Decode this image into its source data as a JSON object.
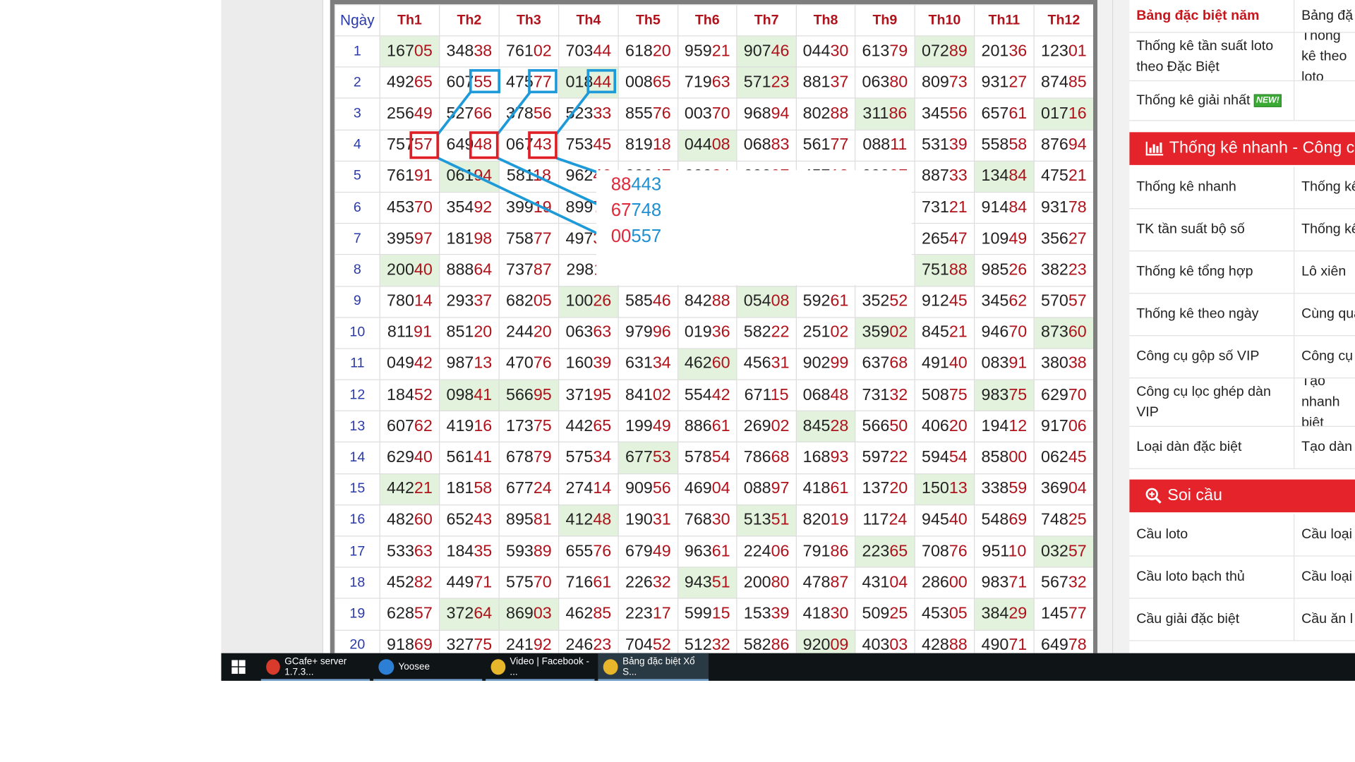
{
  "table": {
    "headers": [
      "Ngày",
      "Th1",
      "Th2",
      "Th3",
      "Th4",
      "Th5",
      "Th6",
      "Th7",
      "Th8",
      "Th9",
      "Th10",
      "Th11",
      "Th12"
    ],
    "rows": [
      {
        "day": "1",
        "cells": [
          {
            "v": "16705",
            "hl": true
          },
          {
            "v": "34838"
          },
          {
            "v": "76102"
          },
          {
            "v": "70344"
          },
          {
            "v": "61820"
          },
          {
            "v": "95921"
          },
          {
            "v": "90746",
            "hl": true
          },
          {
            "v": "04430"
          },
          {
            "v": "61379"
          },
          {
            "v": "07289",
            "hl": true
          },
          {
            "v": "20136"
          },
          {
            "v": "12301"
          }
        ]
      },
      {
        "day": "2",
        "cells": [
          {
            "v": "49265"
          },
          {
            "v": "60755"
          },
          {
            "v": "47577"
          },
          {
            "v": "01844",
            "hl": true
          },
          {
            "v": "00865"
          },
          {
            "v": "71963"
          },
          {
            "v": "57123",
            "hl": true
          },
          {
            "v": "88137"
          },
          {
            "v": "06380"
          },
          {
            "v": "80973"
          },
          {
            "v": "93127"
          },
          {
            "v": "87485"
          }
        ]
      },
      {
        "day": "3",
        "cells": [
          {
            "v": "25649"
          },
          {
            "v": "52766"
          },
          {
            "v": "37856"
          },
          {
            "v": "52333"
          },
          {
            "v": "85576"
          },
          {
            "v": "00370"
          },
          {
            "v": "96894"
          },
          {
            "v": "80288"
          },
          {
            "v": "31186",
            "hl": true
          },
          {
            "v": "34556"
          },
          {
            "v": "65761"
          },
          {
            "v": "01716",
            "hl": true
          }
        ]
      },
      {
        "day": "4",
        "cells": [
          {
            "v": "75757"
          },
          {
            "v": "64948"
          },
          {
            "v": "06743"
          },
          {
            "v": "75345"
          },
          {
            "v": "81918"
          },
          {
            "v": "04408",
            "hl": true
          },
          {
            "v": "06883"
          },
          {
            "v": "56177"
          },
          {
            "v": "08811"
          },
          {
            "v": "53139"
          },
          {
            "v": "55858"
          },
          {
            "v": "87694"
          }
        ]
      },
      {
        "day": "5",
        "cells": [
          {
            "v": "76191"
          },
          {
            "v": "06194",
            "hl": true
          },
          {
            "v": "58118"
          },
          {
            "v": "96246"
          },
          {
            "v": "09047"
          },
          {
            "v": "09034"
          },
          {
            "v": "09097"
          },
          {
            "v": "45718"
          },
          {
            "v": "09097"
          },
          {
            "v": "88733"
          },
          {
            "v": "13484",
            "hl": true
          },
          {
            "v": "47521"
          }
        ]
      },
      {
        "day": "6",
        "cells": [
          {
            "v": "45370"
          },
          {
            "v": "35492"
          },
          {
            "v": "39919"
          },
          {
            "v": "89977"
          },
          {
            "v": ""
          },
          {
            "v": ""
          },
          {
            "v": ""
          },
          {
            "v": ""
          },
          {
            "v": ""
          },
          {
            "v": "73121"
          },
          {
            "v": "91484"
          },
          {
            "v": "93178"
          }
        ]
      },
      {
        "day": "7",
        "cells": [
          {
            "v": "39597"
          },
          {
            "v": "18198"
          },
          {
            "v": "75877"
          },
          {
            "v": "49733"
          },
          {
            "v": ""
          },
          {
            "v": ""
          },
          {
            "v": ""
          },
          {
            "v": ""
          },
          {
            "v": ""
          },
          {
            "v": "26547"
          },
          {
            "v": "10949"
          },
          {
            "v": "35627"
          }
        ]
      },
      {
        "day": "8",
        "cells": [
          {
            "v": "20040",
            "hl": true
          },
          {
            "v": "88864"
          },
          {
            "v": "73787"
          },
          {
            "v": "29811"
          },
          {
            "v": ""
          },
          {
            "v": ""
          },
          {
            "v": ""
          },
          {
            "v": ""
          },
          {
            "v": ""
          },
          {
            "v": "75188",
            "hl": true
          },
          {
            "v": "98526"
          },
          {
            "v": "38223"
          }
        ]
      },
      {
        "day": "9",
        "cells": [
          {
            "v": "78014"
          },
          {
            "v": "29337"
          },
          {
            "v": "68205"
          },
          {
            "v": "10026",
            "hl": true
          },
          {
            "v": "58546"
          },
          {
            "v": "84288"
          },
          {
            "v": "05408",
            "hl": true
          },
          {
            "v": "59261"
          },
          {
            "v": "35252"
          },
          {
            "v": "91245"
          },
          {
            "v": "34562"
          },
          {
            "v": "57057"
          }
        ]
      },
      {
        "day": "10",
        "cells": [
          {
            "v": "81191"
          },
          {
            "v": "85120"
          },
          {
            "v": "24420"
          },
          {
            "v": "06363"
          },
          {
            "v": "97996"
          },
          {
            "v": "01936"
          },
          {
            "v": "58222"
          },
          {
            "v": "25102"
          },
          {
            "v": "35902",
            "hl": true
          },
          {
            "v": "84521"
          },
          {
            "v": "94670"
          },
          {
            "v": "87360",
            "hl": true
          }
        ]
      },
      {
        "day": "11",
        "cells": [
          {
            "v": "04942"
          },
          {
            "v": "98713"
          },
          {
            "v": "47076"
          },
          {
            "v": "16039"
          },
          {
            "v": "63134"
          },
          {
            "v": "46260",
            "hl": true
          },
          {
            "v": "45631"
          },
          {
            "v": "90299"
          },
          {
            "v": "63768"
          },
          {
            "v": "49140"
          },
          {
            "v": "08391"
          },
          {
            "v": "38038"
          }
        ]
      },
      {
        "day": "12",
        "cells": [
          {
            "v": "18452"
          },
          {
            "v": "09841",
            "hl": true
          },
          {
            "v": "56695",
            "hl": true
          },
          {
            "v": "37195"
          },
          {
            "v": "84102"
          },
          {
            "v": "55442"
          },
          {
            "v": "67115"
          },
          {
            "v": "06848"
          },
          {
            "v": "73132"
          },
          {
            "v": "50875"
          },
          {
            "v": "98375",
            "hl": true
          },
          {
            "v": "62970"
          }
        ]
      },
      {
        "day": "13",
        "cells": [
          {
            "v": "60762"
          },
          {
            "v": "41916"
          },
          {
            "v": "17375"
          },
          {
            "v": "44265"
          },
          {
            "v": "19949"
          },
          {
            "v": "88661"
          },
          {
            "v": "26902"
          },
          {
            "v": "84528",
            "hl": true
          },
          {
            "v": "56650"
          },
          {
            "v": "40620"
          },
          {
            "v": "19412"
          },
          {
            "v": "91706"
          }
        ]
      },
      {
        "day": "14",
        "cells": [
          {
            "v": "62940"
          },
          {
            "v": "56141"
          },
          {
            "v": "67879"
          },
          {
            "v": "57534"
          },
          {
            "v": "67753",
            "hl": true
          },
          {
            "v": "57854"
          },
          {
            "v": "78668"
          },
          {
            "v": "16893"
          },
          {
            "v": "59722"
          },
          {
            "v": "59454"
          },
          {
            "v": "85800"
          },
          {
            "v": "06245"
          }
        ]
      },
      {
        "day": "15",
        "cells": [
          {
            "v": "44221",
            "hl": true
          },
          {
            "v": "18158"
          },
          {
            "v": "67724"
          },
          {
            "v": "27414"
          },
          {
            "v": "90956"
          },
          {
            "v": "46904"
          },
          {
            "v": "08897"
          },
          {
            "v": "41861"
          },
          {
            "v": "13720"
          },
          {
            "v": "15013",
            "hl": true
          },
          {
            "v": "33859"
          },
          {
            "v": "36904"
          }
        ]
      },
      {
        "day": "16",
        "cells": [
          {
            "v": "48260"
          },
          {
            "v": "65243"
          },
          {
            "v": "89581"
          },
          {
            "v": "41248",
            "hl": true
          },
          {
            "v": "19031"
          },
          {
            "v": "76830"
          },
          {
            "v": "51351",
            "hl": true
          },
          {
            "v": "82019"
          },
          {
            "v": "11724"
          },
          {
            "v": "94540"
          },
          {
            "v": "54869"
          },
          {
            "v": "74825"
          }
        ]
      },
      {
        "day": "17",
        "cells": [
          {
            "v": "53363"
          },
          {
            "v": "18435"
          },
          {
            "v": "59389"
          },
          {
            "v": "65576"
          },
          {
            "v": "67949"
          },
          {
            "v": "96361"
          },
          {
            "v": "22406"
          },
          {
            "v": "79186"
          },
          {
            "v": "22365",
            "hl": true
          },
          {
            "v": "70876"
          },
          {
            "v": "95110"
          },
          {
            "v": "03257",
            "hl": true
          }
        ]
      },
      {
        "day": "18",
        "cells": [
          {
            "v": "45282"
          },
          {
            "v": "44971"
          },
          {
            "v": "57570"
          },
          {
            "v": "71661"
          },
          {
            "v": "22632"
          },
          {
            "v": "94351",
            "hl": true
          },
          {
            "v": "20080"
          },
          {
            "v": "47887"
          },
          {
            "v": "43104"
          },
          {
            "v": "28600"
          },
          {
            "v": "98371"
          },
          {
            "v": "56732"
          }
        ]
      },
      {
        "day": "19",
        "cells": [
          {
            "v": "62857"
          },
          {
            "v": "37264",
            "hl": true
          },
          {
            "v": "86903",
            "hl": true
          },
          {
            "v": "46285"
          },
          {
            "v": "22317"
          },
          {
            "v": "59915"
          },
          {
            "v": "15339"
          },
          {
            "v": "41830"
          },
          {
            "v": "50925"
          },
          {
            "v": "45305"
          },
          {
            "v": "38429",
            "hl": true
          },
          {
            "v": "14577"
          }
        ]
      },
      {
        "day": "20",
        "cells": [
          {
            "v": "91869"
          },
          {
            "v": "32775"
          },
          {
            "v": "24192"
          },
          {
            "v": "24623"
          },
          {
            "v": "70452"
          },
          {
            "v": "51232"
          },
          {
            "v": "58286"
          },
          {
            "v": "92009",
            "hl": true
          },
          {
            "v": "40303"
          },
          {
            "v": "42888"
          },
          {
            "v": "49071"
          },
          {
            "v": "64978"
          }
        ]
      }
    ]
  },
  "annotations": {
    "popup_numbers": [
      {
        "a": "88",
        "b": "443"
      },
      {
        "a": "67",
        "b": "748"
      },
      {
        "a": "00",
        "b": "557"
      }
    ],
    "blue_color": "#1e9ad8",
    "red_color": "#e01e25"
  },
  "sidebar": {
    "top_rows": [
      {
        "c1": "Bảng đặc biệt năm",
        "c2": "Bảng đặ",
        "bold_red": true
      },
      {
        "c1": "Thống kê tần suất loto theo Đặc Biệt",
        "c2": "Thống kê theo loto"
      },
      {
        "c1": "Thống kê giải nhất",
        "c2": "",
        "badge": "NEW!"
      }
    ],
    "section1_title": "Thống kê nhanh - Công cụ",
    "section1_rows": [
      {
        "c1": "Thống kê nhanh",
        "c2": "Thống kê"
      },
      {
        "c1": "TK tần suất bộ số",
        "c2": "Thống kê"
      },
      {
        "c1": "Thống kê tổng hợp",
        "c2": "Lô xiên"
      },
      {
        "c1": "Thống kê theo ngày",
        "c2": "Cùng quay"
      },
      {
        "c1": "Công cụ gộp số VIP",
        "c2": "Công cụ"
      },
      {
        "c1": "Công cụ lọc ghép dàn VIP",
        "c2": "Tạo nhanh biệt"
      },
      {
        "c1": "Loại dàn đặc biệt",
        "c2": "Tạo dàn"
      }
    ],
    "section2_title": "Soi cầu",
    "section2_rows": [
      {
        "c1": "Cầu loto",
        "c2": "Cầu loại"
      },
      {
        "c1": "Cầu loto bạch thủ",
        "c2": "Cầu loại"
      },
      {
        "c1": "Cầu giải đặc biệt",
        "c2": "Cầu ăn l"
      }
    ]
  },
  "taskbar": {
    "items": [
      {
        "label": "GCafe+ server 1.7.3...",
        "color": "#d83b2b"
      },
      {
        "label": "Yoosee",
        "color": "#2d7fd6"
      },
      {
        "label": "Video | Facebook - ...",
        "color": "#e8b62a"
      },
      {
        "label": "Bảng đặc biệt Xổ S...",
        "color": "#e8b62a"
      }
    ]
  }
}
